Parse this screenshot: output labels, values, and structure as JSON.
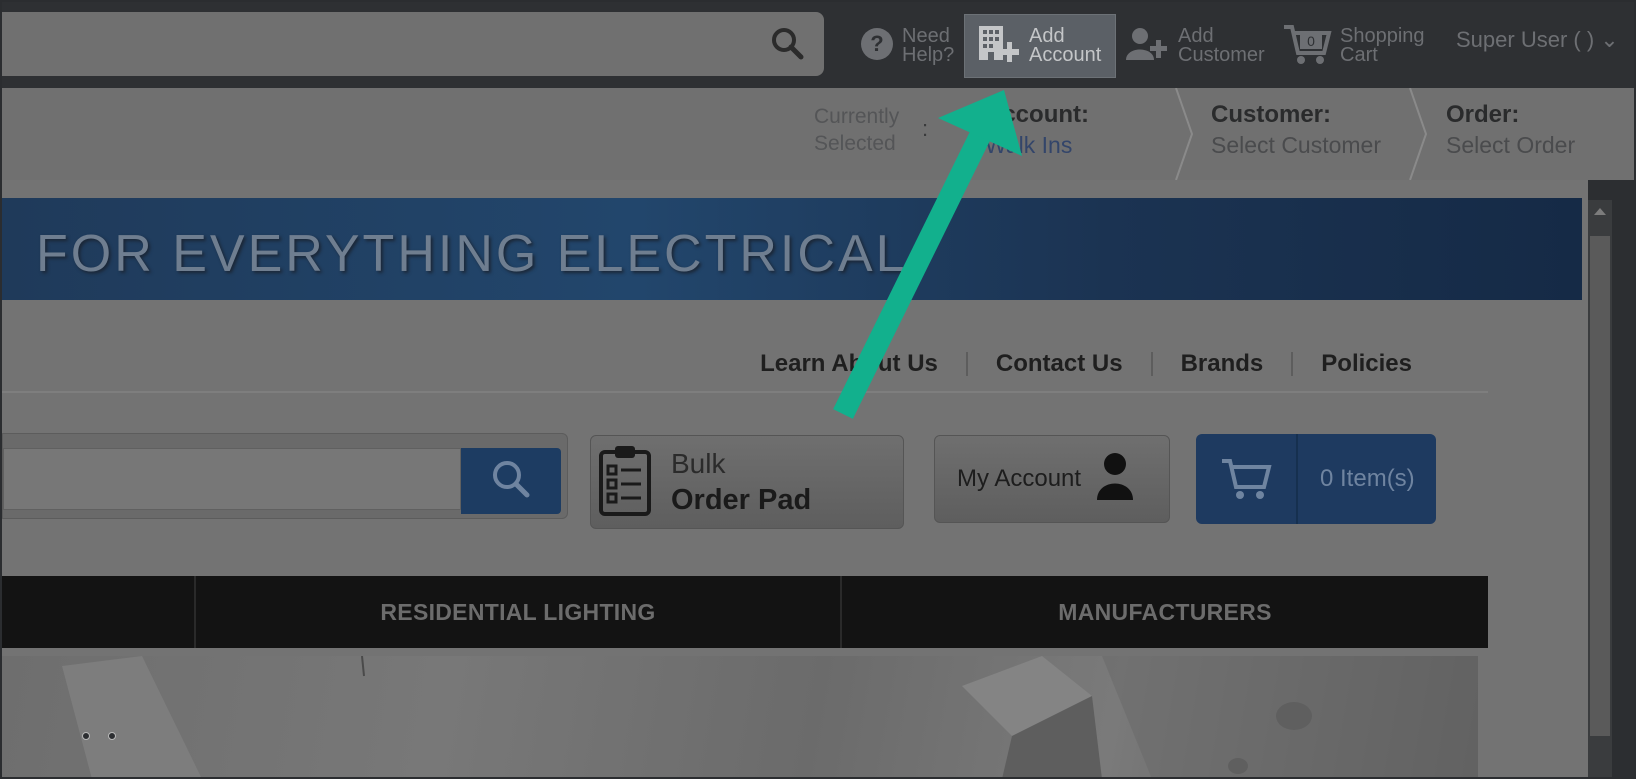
{
  "topbar": {
    "help_line1": "Need",
    "help_line2": "Help?",
    "add_account_line1": "Add",
    "add_account_line2": "Account",
    "add_customer_line1": "Add",
    "add_customer_line2": "Customer",
    "cart_line1": "Shopping",
    "cart_line2": "Cart",
    "cart_count": "0",
    "user_label": "Super User ( ) ⌄"
  },
  "context": {
    "currently_line1": "Currently",
    "currently_line2": "Selected",
    "colon": ":",
    "account_title": "Account:",
    "account_value": "Walk Ins",
    "customer_title": "Customer:",
    "customer_value": "Select Customer",
    "order_title": "Order:",
    "order_value": "Select Order"
  },
  "banner": {
    "text": "FOR EVERYTHING ELECTRICAL"
  },
  "toplinks": [
    "Learn About Us",
    "Contact Us",
    "Brands",
    "Policies"
  ],
  "bulk": {
    "line1": "Bulk",
    "line2": "Order Pad"
  },
  "my_account": {
    "label": "My Account"
  },
  "cart_button": {
    "label": "0 Item(s)"
  },
  "nav": [
    "",
    "RESIDENTIAL LIGHTING",
    "MANUFACTURERS"
  ],
  "colors": {
    "arrow": "#12b08d",
    "highlight": "#5b6066",
    "banner": "#1f3a5a"
  },
  "icons": [
    "search-icon",
    "help-icon",
    "add-account-icon",
    "add-customer-icon",
    "cart-icon",
    "clipboard-icon",
    "user-icon",
    "scroll-up-icon"
  ]
}
